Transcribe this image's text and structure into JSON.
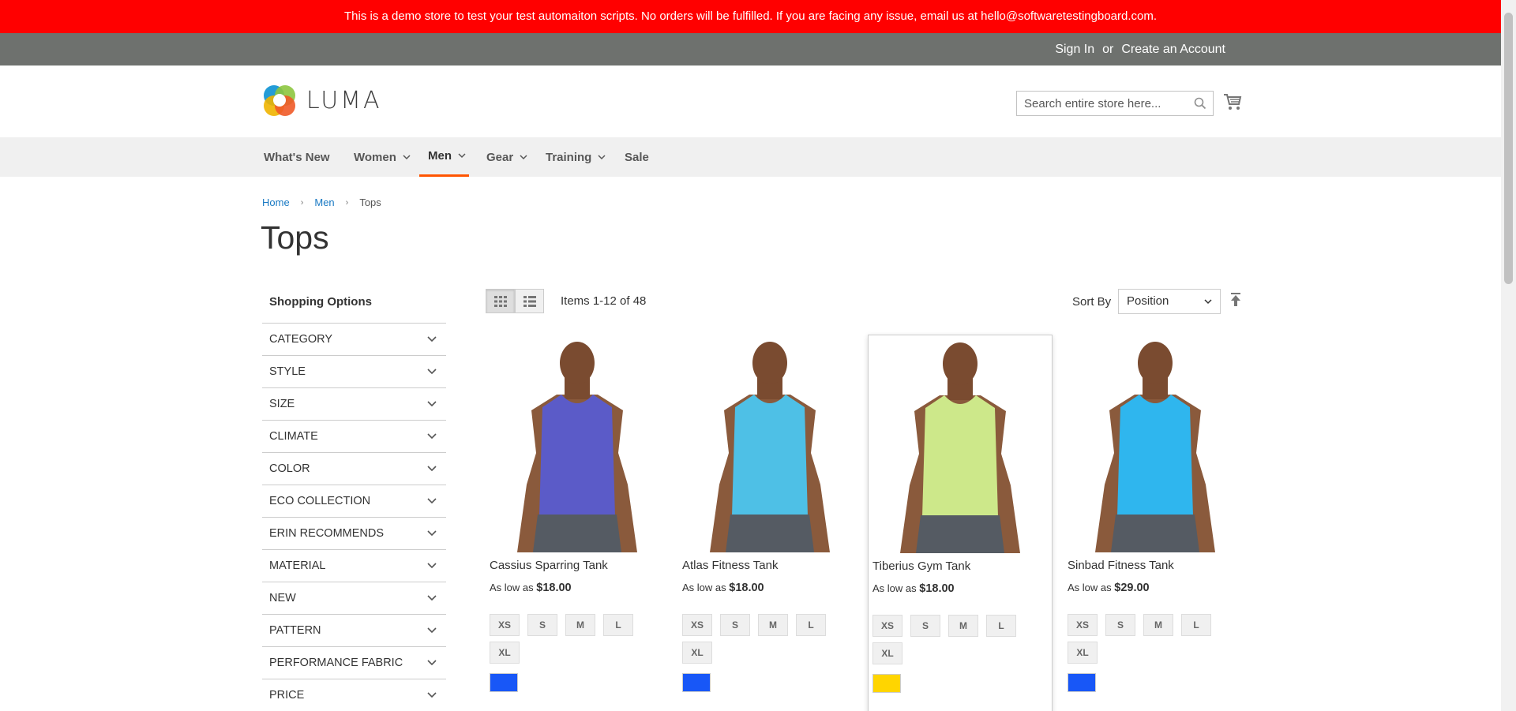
{
  "demo_notice": "This is a demo store to test your test automaiton scripts. No orders will be fulfilled. If you are facing any issue, email us at hello@softwaretestingboard.com.",
  "top_links": {
    "sign_in": "Sign In",
    "or": "or",
    "create_account": "Create an Account"
  },
  "logo": {
    "text": "LUMA"
  },
  "search": {
    "placeholder": "Search entire store here..."
  },
  "nav": {
    "items": [
      {
        "label": "What's New",
        "dropdown": false
      },
      {
        "label": "Women",
        "dropdown": true
      },
      {
        "label": "Men",
        "dropdown": true,
        "active": true
      },
      {
        "label": "Gear",
        "dropdown": true
      },
      {
        "label": "Training",
        "dropdown": true
      },
      {
        "label": "Sale",
        "dropdown": false
      }
    ]
  },
  "breadcrumbs": {
    "home": "Home",
    "men": "Men",
    "current": "Tops"
  },
  "page_title": "Tops",
  "sidebar": {
    "title": "Shopping Options",
    "filters": [
      "CATEGORY",
      "STYLE",
      "SIZE",
      "CLIMATE",
      "COLOR",
      "ECO COLLECTION",
      "ERIN RECOMMENDS",
      "MATERIAL",
      "NEW",
      "PATTERN",
      "PERFORMANCE FABRIC",
      "PRICE"
    ]
  },
  "toolbar": {
    "amount": "Items 1-12 of 48",
    "sort_label": "Sort By",
    "sort_value": "Position"
  },
  "products": [
    {
      "name": "Cassius Sparring Tank",
      "price_prefix": "As low as",
      "price": "$18.00",
      "sizes": [
        "XS",
        "S",
        "M",
        "L",
        "XL"
      ],
      "color": "#1857f7",
      "shirt_color": "#5b5bc8"
    },
    {
      "name": "Atlas Fitness Tank",
      "price_prefix": "As low as",
      "price": "$18.00",
      "sizes": [
        "XS",
        "S",
        "M",
        "L",
        "XL"
      ],
      "color": "#1857f7",
      "shirt_color": "#4ec0e6"
    },
    {
      "name": "Tiberius Gym Tank",
      "price_prefix": "As low as",
      "price": "$18.00",
      "sizes": [
        "XS",
        "S",
        "M",
        "L",
        "XL"
      ],
      "color": "#ffd500",
      "shirt_color": "#cde88a"
    },
    {
      "name": "Sinbad Fitness Tank",
      "price_prefix": "As low as",
      "price": "$29.00",
      "sizes": [
        "XS",
        "S",
        "M",
        "L",
        "XL"
      ],
      "color": "#1857f7",
      "shirt_color": "#2fb6ee"
    }
  ]
}
